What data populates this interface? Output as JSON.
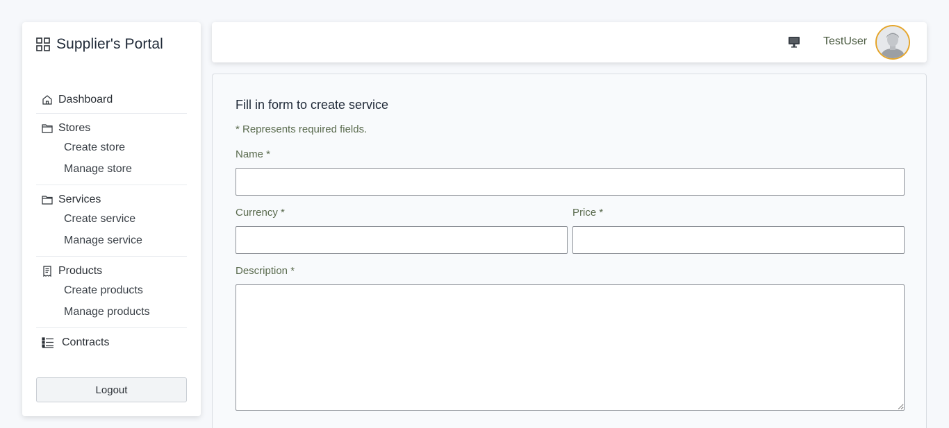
{
  "sidebar": {
    "brand_title": "Supplier's Portal",
    "brand_icon": "grid-icon",
    "nav": {
      "dashboard": "Dashboard",
      "stores": "Stores",
      "create_store": "Create store",
      "manage_store": "Manage store",
      "services": "Services",
      "create_service": "Create service",
      "manage_service": "Manage service",
      "products": "Products",
      "create_products": "Create products",
      "manage_products": "Manage products",
      "contracts": "Contracts"
    },
    "logout_label": "Logout"
  },
  "topbar": {
    "username": "TestUser",
    "monitor_icon": "monitor-icon",
    "avatar_border_color": "#e5a52a"
  },
  "form": {
    "title": "Fill in form to create service",
    "required_note": "* Represents required fields.",
    "name_label": "Name *",
    "name_value": "",
    "currency_label": "Currency *",
    "currency_value": "",
    "price_label": "Price *",
    "price_value": "",
    "description_label": "Description *",
    "description_value": ""
  },
  "colors": {
    "page_bg": "#f6f8fb",
    "label_text": "#5a6b4e",
    "input_border": "#8c9096"
  }
}
